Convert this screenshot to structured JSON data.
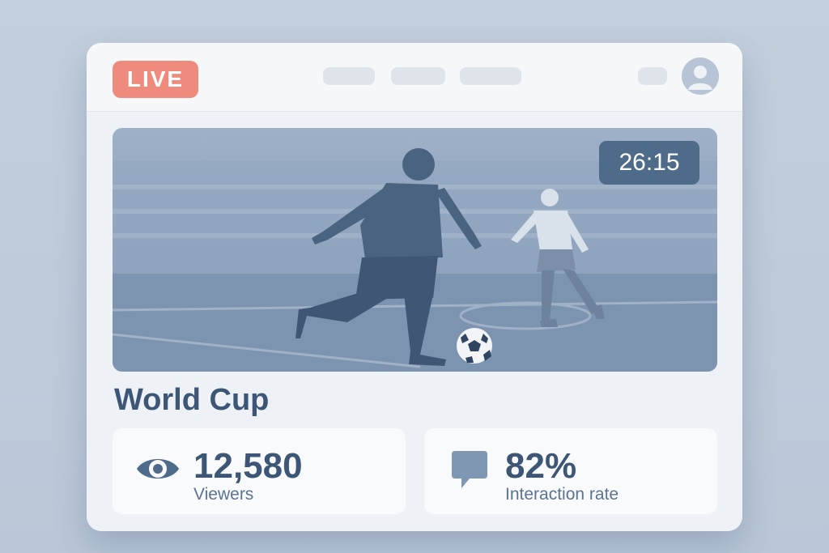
{
  "header": {
    "live_label": "LIVE",
    "nav_items": [
      "",
      "",
      ""
    ],
    "user_icon": "user-avatar-icon"
  },
  "video": {
    "timer": "26:15"
  },
  "event": {
    "title": "World Cup"
  },
  "stats": [
    {
      "icon": "eye-icon",
      "value": "12,580",
      "label": "Viewers"
    },
    {
      "icon": "chat-bubble-icon",
      "value": "82%",
      "label": "Interaction rate"
    }
  ],
  "colors": {
    "live_badge": "#ee8b7c",
    "accent_text": "#3e5675",
    "timer_bg": "#4f6b8a"
  }
}
